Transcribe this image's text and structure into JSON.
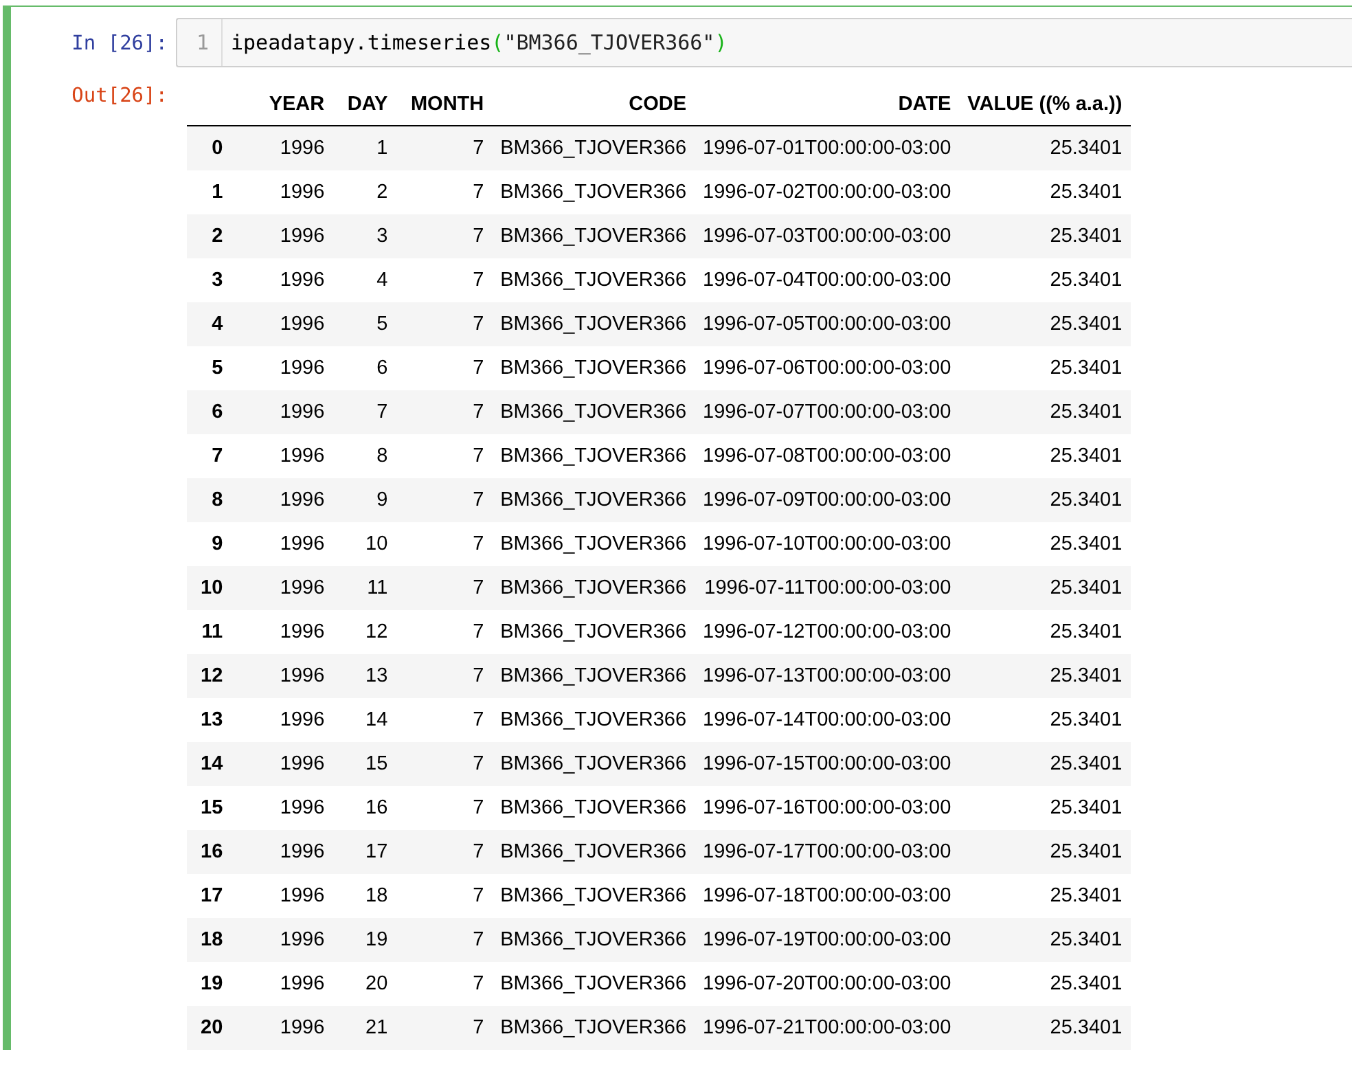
{
  "input": {
    "prompt": "In [26]:",
    "line_number": "1",
    "tokens": [
      {
        "text": "ipeadatapy.timeseries",
        "kind": "name"
      },
      {
        "text": "(",
        "kind": "paren"
      },
      {
        "text": "\"BM366_TJOVER366\"",
        "kind": "string"
      },
      {
        "text": ")",
        "kind": "paren"
      }
    ]
  },
  "output": {
    "prompt": "Out[26]:",
    "table": {
      "columns": [
        "",
        "YEAR",
        "DAY",
        "MONTH",
        "CODE",
        "DATE",
        "VALUE ((% a.a.))"
      ],
      "rows": [
        [
          "0",
          "1996",
          "1",
          "7",
          "BM366_TJOVER366",
          "1996-07-01T00:00:00-03:00",
          "25.3401"
        ],
        [
          "1",
          "1996",
          "2",
          "7",
          "BM366_TJOVER366",
          "1996-07-02T00:00:00-03:00",
          "25.3401"
        ],
        [
          "2",
          "1996",
          "3",
          "7",
          "BM366_TJOVER366",
          "1996-07-03T00:00:00-03:00",
          "25.3401"
        ],
        [
          "3",
          "1996",
          "4",
          "7",
          "BM366_TJOVER366",
          "1996-07-04T00:00:00-03:00",
          "25.3401"
        ],
        [
          "4",
          "1996",
          "5",
          "7",
          "BM366_TJOVER366",
          "1996-07-05T00:00:00-03:00",
          "25.3401"
        ],
        [
          "5",
          "1996",
          "6",
          "7",
          "BM366_TJOVER366",
          "1996-07-06T00:00:00-03:00",
          "25.3401"
        ],
        [
          "6",
          "1996",
          "7",
          "7",
          "BM366_TJOVER366",
          "1996-07-07T00:00:00-03:00",
          "25.3401"
        ],
        [
          "7",
          "1996",
          "8",
          "7",
          "BM366_TJOVER366",
          "1996-07-08T00:00:00-03:00",
          "25.3401"
        ],
        [
          "8",
          "1996",
          "9",
          "7",
          "BM366_TJOVER366",
          "1996-07-09T00:00:00-03:00",
          "25.3401"
        ],
        [
          "9",
          "1996",
          "10",
          "7",
          "BM366_TJOVER366",
          "1996-07-10T00:00:00-03:00",
          "25.3401"
        ],
        [
          "10",
          "1996",
          "11",
          "7",
          "BM366_TJOVER366",
          "1996-07-11T00:00:00-03:00",
          "25.3401"
        ],
        [
          "11",
          "1996",
          "12",
          "7",
          "BM366_TJOVER366",
          "1996-07-12T00:00:00-03:00",
          "25.3401"
        ],
        [
          "12",
          "1996",
          "13",
          "7",
          "BM366_TJOVER366",
          "1996-07-13T00:00:00-03:00",
          "25.3401"
        ],
        [
          "13",
          "1996",
          "14",
          "7",
          "BM366_TJOVER366",
          "1996-07-14T00:00:00-03:00",
          "25.3401"
        ],
        [
          "14",
          "1996",
          "15",
          "7",
          "BM366_TJOVER366",
          "1996-07-15T00:00:00-03:00",
          "25.3401"
        ],
        [
          "15",
          "1996",
          "16",
          "7",
          "BM366_TJOVER366",
          "1996-07-16T00:00:00-03:00",
          "25.3401"
        ],
        [
          "16",
          "1996",
          "17",
          "7",
          "BM366_TJOVER366",
          "1996-07-17T00:00:00-03:00",
          "25.3401"
        ],
        [
          "17",
          "1996",
          "18",
          "7",
          "BM366_TJOVER366",
          "1996-07-18T00:00:00-03:00",
          "25.3401"
        ],
        [
          "18",
          "1996",
          "19",
          "7",
          "BM366_TJOVER366",
          "1996-07-19T00:00:00-03:00",
          "25.3401"
        ],
        [
          "19",
          "1996",
          "20",
          "7",
          "BM366_TJOVER366",
          "1996-07-20T00:00:00-03:00",
          "25.3401"
        ],
        [
          "20",
          "1996",
          "21",
          "7",
          "BM366_TJOVER366",
          "1996-07-21T00:00:00-03:00",
          "25.3401"
        ]
      ]
    }
  }
}
